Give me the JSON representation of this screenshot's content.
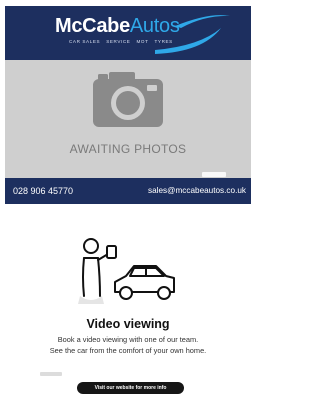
{
  "dealer": {
    "brand_part1": "McCabe",
    "brand_part2": "Autos",
    "services": [
      "CAR SALES",
      "SERVICE",
      "MOT",
      "TYRES"
    ],
    "awaiting_text": "AWAITING PHOTOS",
    "phone": "028 906 45770",
    "email": "sales@mccabeautos.co.uk",
    "colors": {
      "navy": "#1d2f5f",
      "accent": "#2fa8e8",
      "placeholder_bg": "#cfcfcf"
    }
  },
  "video": {
    "title": "Video viewing",
    "line1": "Book a video viewing with one of our team.",
    "line2": "See the car from the comfort of your own home.",
    "button_label": "Visit our website for more info",
    "icon": "video-call-car-icon"
  }
}
